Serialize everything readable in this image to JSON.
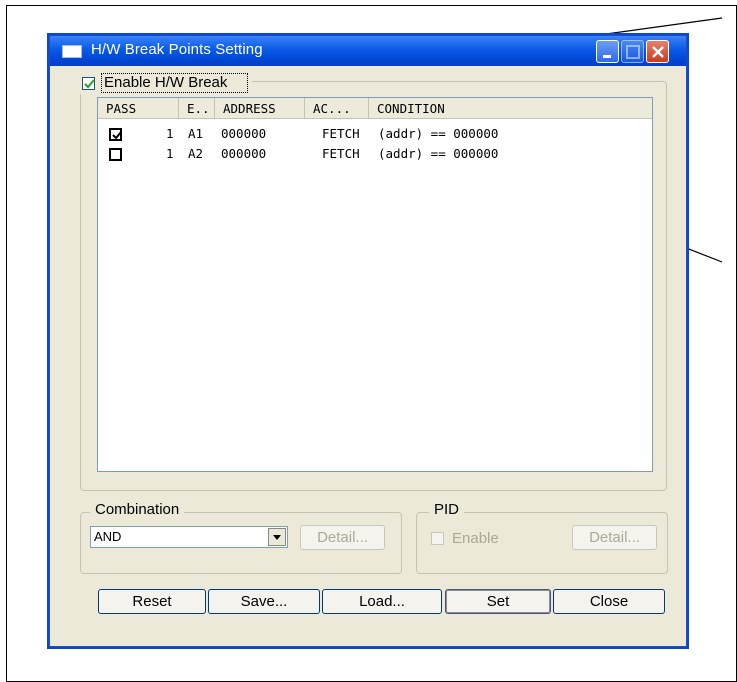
{
  "window": {
    "title": "H/W Break Points Setting"
  },
  "enable_hw_break": {
    "label": "Enable H/W Break",
    "checked": true
  },
  "table": {
    "columns": [
      "PASS",
      "E..",
      "ADDRESS",
      "AC...",
      "CONDITION"
    ],
    "rows": [
      {
        "checked": true,
        "pass": "1",
        "e": "A1",
        "address": "000000",
        "ac": "FETCH",
        "condition": "(addr) == 000000"
      },
      {
        "checked": false,
        "pass": "1",
        "e": "A2",
        "address": "000000",
        "ac": "FETCH",
        "condition": "(addr) == 000000"
      }
    ]
  },
  "combination": {
    "label": "Combination",
    "value": "AND",
    "detail_label": "Detail..."
  },
  "pid": {
    "label": "PID",
    "enable_label": "Enable",
    "enable_checked": false,
    "detail_label": "Detail..."
  },
  "buttons": {
    "reset": "Reset",
    "save": "Save...",
    "load": "Load...",
    "set": "Set",
    "close": "Close"
  },
  "colors": {
    "titlebar": "#0a5ae6",
    "window_bg": "#ece9d8",
    "close_button": "#c93b1f"
  }
}
